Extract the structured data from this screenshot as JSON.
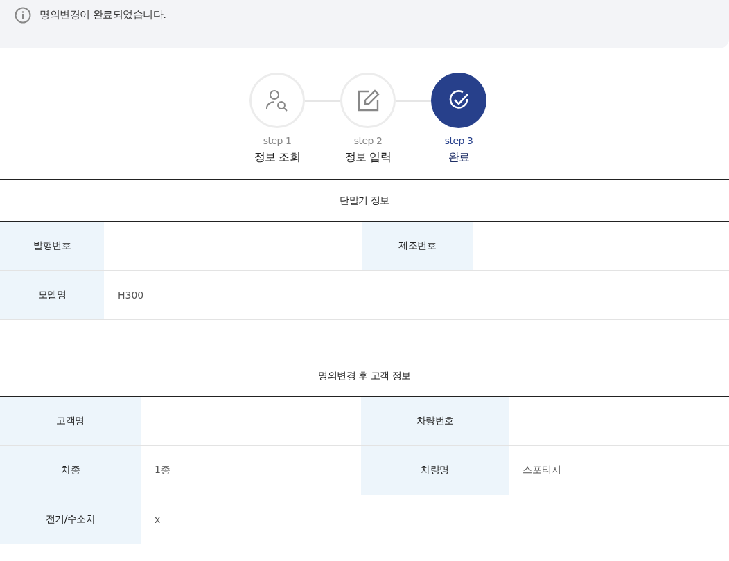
{
  "notice": {
    "text": "명의변경이 완료되었습니다."
  },
  "steps": [
    {
      "number": "step 1",
      "label": "정보 조회",
      "selected": false,
      "kind": "search"
    },
    {
      "number": "step 2",
      "label": "정보 입력",
      "selected": false,
      "kind": "edit"
    },
    {
      "number": "step 3",
      "label": "완료",
      "selected": true,
      "kind": "check"
    }
  ],
  "sections": [
    {
      "title": "단말기 정보",
      "rows": [
        [
          {
            "label": "발행번호"
          },
          {
            "label": "제조번호"
          }
        ],
        [
          {
            "label": "모델명",
            "value": "H300"
          }
        ]
      ]
    },
    {
      "title": "명의변경 후 고객 정보",
      "rows": [
        [
          {
            "label": "고객명"
          },
          {
            "label": "차량번호"
          }
        ],
        [
          {
            "label": "차종",
            "value": "1종"
          },
          {
            "label": "차량명",
            "value": "스포티지"
          }
        ],
        [
          {
            "label": "전기/수소차",
            "value": "x"
          }
        ]
      ]
    }
  ]
}
